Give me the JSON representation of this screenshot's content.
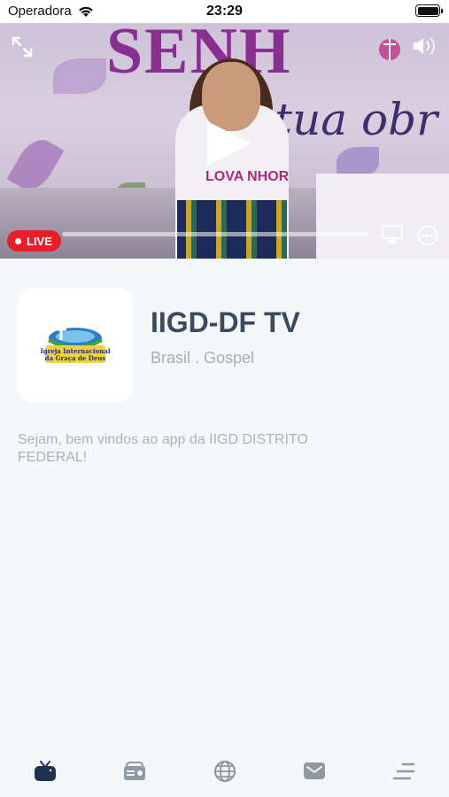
{
  "status_bar": {
    "carrier": "Operadora",
    "time": "23:29"
  },
  "player": {
    "live_label": "LIVE",
    "banner_text": "SENH",
    "banner_script": "tua obr",
    "shirt_text": "LOVA NHOR",
    "accent_color": "#e5202a"
  },
  "channel": {
    "title": "IIGD-DF TV",
    "subtitle": "Brasil . Gospel",
    "description": "Sejam, bem vindos ao app da IIGD DISTRITO FEDERAL!",
    "logo_text": "Igreja Internacional da Graça de Deus"
  },
  "tabs": [
    {
      "icon": "tv-icon",
      "active": true
    },
    {
      "icon": "radio-icon",
      "active": false
    },
    {
      "icon": "globe-icon",
      "active": false
    },
    {
      "icon": "mail-icon",
      "active": false
    },
    {
      "icon": "menu-icon",
      "active": false
    }
  ],
  "colors": {
    "tab_active": "#1d3350",
    "tab_inactive": "#8e99a4",
    "title": "#3a4b60",
    "background": "#f4f8fa"
  }
}
